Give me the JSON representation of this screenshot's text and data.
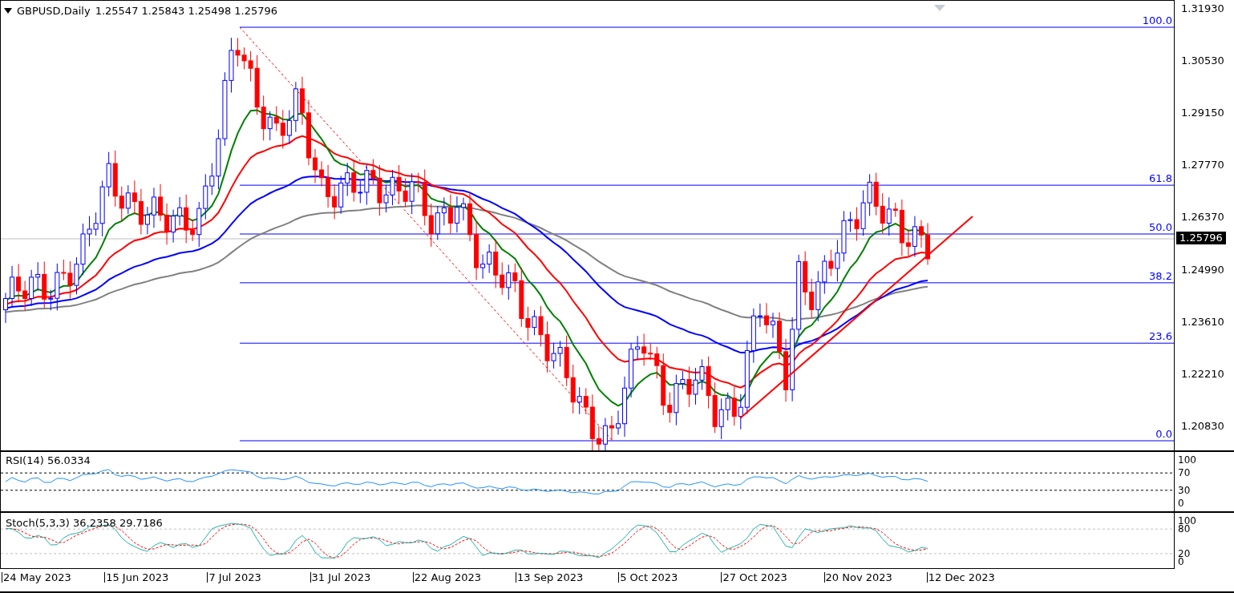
{
  "chart_header": {
    "symbol": "GBPUSD,Daily",
    "ohlc": "1.25547 1.25843 1.25498 1.25796"
  },
  "price_axis": [
    "1.31930",
    "1.30530",
    "1.29150",
    "1.27770",
    "1.26370",
    "1.24990",
    "1.23610",
    "1.22210",
    "1.20830"
  ],
  "current_price": "1.25796",
  "fibonacci_levels": [
    "100.0",
    "61.8",
    "50.0",
    "38.2",
    "23.6",
    "0.0"
  ],
  "rsi_panel": {
    "title": "RSI(14) 56.0334",
    "axis": [
      "100",
      "70",
      "30",
      "0"
    ]
  },
  "stoch_panel": {
    "title": "Stoch(5,3,3) 36.2358 29.7186",
    "axis": [
      "100",
      "80",
      "20",
      "0"
    ]
  },
  "date_axis": [
    "24 May 2023",
    "15 Jun 2023",
    "7 Jul 2023",
    "31 Jul 2023",
    "22 Aug 2023",
    "13 Sep 2023",
    "5 Oct 2023",
    "27 Oct 2023",
    "20 Nov 2023",
    "12 Dec 2023"
  ]
}
